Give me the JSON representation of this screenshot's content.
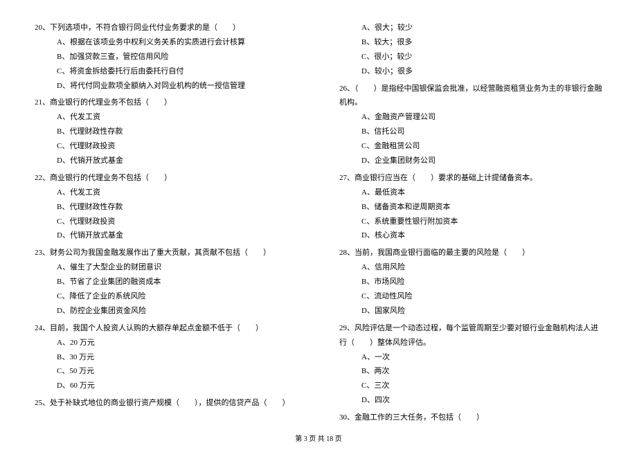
{
  "left": [
    {
      "stem": "20、下列选项中，不符合银行同业代付业务要求的是（　　）",
      "opts": [
        "A、根据在该项业务中权利义务关系的实质进行会计核算",
        "B、加强贷款三查，管控信用风险",
        "C、将资金拆给委托行后由委托行自付",
        "D、将代付同业款项全额纳入对同业机构的统一授信管理"
      ]
    },
    {
      "stem": "21、商业银行的代理业务不包括（　　）",
      "opts": [
        "A、代发工资",
        "B、代理财政性存款",
        "C、代理财政投资",
        "D、代销开放式基金"
      ]
    },
    {
      "stem": "22、商业银行的代理业务不包括（　　）",
      "opts": [
        "A、代发工资",
        "B、代理财政性存款",
        "C、代理财政投资",
        "D、代销开放式基金"
      ]
    },
    {
      "stem": "23、财务公司为我国金融发展作出了重大贡献，其贡献不包括（　　）",
      "opts": [
        "A、催生了大型企业的财团意识",
        "B、节省了企业集团的融资成本",
        "C、降低了企业的系统风险",
        "D、防控企业集团资金风险"
      ]
    },
    {
      "stem": "24、目前，我国个人投资人认购的大额存单起点金额不低于（　　）",
      "opts": [
        "A、20 万元",
        "B、30 万元",
        "C、50 万元",
        "D、60 万元"
      ]
    },
    {
      "stem": "25、处于补缺式地位的商业银行资产规模（　　），提供的信贷产品（　　）",
      "opts": []
    }
  ],
  "right": [
    {
      "stem": "",
      "opts": [
        "A、很大；较少",
        "B、较大；很多",
        "C、很小；较少",
        "D、较小；很多"
      ]
    },
    {
      "stem": "26、（　　）是指经中国银保监会批准，以经营融资租赁业务为主的非银行金融机构。",
      "opts": [
        "A、金融资产管理公司",
        "B、信托公司",
        "C、金融租赁公司",
        "D、企业集团财务公司"
      ]
    },
    {
      "stem": "27、商业银行应当在（　　）要求的基础上计提储备资本。",
      "opts": [
        "A、最低资本",
        "B、储备资本和逆周期资本",
        "C、系统重要性银行附加资本",
        "D、核心资本"
      ]
    },
    {
      "stem": "28、当前，我国商业银行面临的最主要的风险是（　　）",
      "opts": [
        "A、信用风险",
        "B、市场风险",
        "C、流动性风险",
        "D、国家风险"
      ]
    },
    {
      "stem": "29、风险评估是一个动态过程，每个监管周期至少要对银行业金融机构法人进行（　　）整体风险评估。",
      "opts": [
        "A、一次",
        "B、两次",
        "C、三次",
        "D、四次"
      ]
    },
    {
      "stem": "30、金融工作的三大任务，不包括（　　）",
      "opts": []
    }
  ],
  "footer": "第 3 页 共 18 页"
}
